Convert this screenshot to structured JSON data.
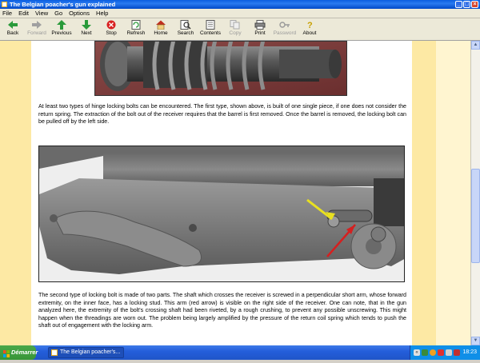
{
  "window": {
    "title": "The Belgian poacher's gun explained",
    "buttons": [
      "_",
      "□",
      "×"
    ]
  },
  "menu": [
    "File",
    "Edit",
    "View",
    "Go",
    "Options",
    "Help"
  ],
  "toolbar": [
    {
      "label": "Back",
      "icon": "back-arrow-icon",
      "enabled": true
    },
    {
      "label": "Forward",
      "icon": "forward-arrow-icon",
      "enabled": false
    },
    {
      "label": "Previous",
      "icon": "up-arrow-icon",
      "enabled": true
    },
    {
      "label": "Next",
      "icon": "down-arrow-icon",
      "enabled": true
    },
    {
      "label": "Stop",
      "icon": "stop-icon",
      "enabled": true
    },
    {
      "label": "Refresh",
      "icon": "refresh-icon",
      "enabled": true
    },
    {
      "label": "Home",
      "icon": "home-icon",
      "enabled": true
    },
    {
      "label": "Search",
      "icon": "search-icon",
      "enabled": true
    },
    {
      "label": "Contents",
      "icon": "contents-icon",
      "enabled": true
    },
    {
      "label": "Copy",
      "icon": "copy-icon",
      "enabled": false
    },
    {
      "label": "Print",
      "icon": "print-icon",
      "enabled": true
    },
    {
      "label": "Password",
      "icon": "password-icon",
      "enabled": false
    },
    {
      "label": "About",
      "icon": "about-icon",
      "enabled": true
    }
  ],
  "content": {
    "para1": "At least two types of hinge locking bolts can be encountered. The first type, shown above, is built of one single piece, if one does not consider the return spring. The extraction of the bolt out of the receiver requires that the barrel is first removed. Once the barrel is removed, the locking bolt can be pulled off by the left side.",
    "para2": "The second type of locking bolt is made of two parts. The shaft which crosses the receiver is screwed in a perpendicular short arm, whose forward extremity, on the inner face, has a locking stud. This arm (red arrow) is visible on the right side of the receiver. One can note, that in the gun analyzed here, the extremity of the bolt's crossing shaft had been riveted, by a rough crushing, to prevent any possible unscrewing. This might happen when the threadings are worn out. The problem being largely amplified by the pressure of the return coil spring which tends to push the shaft out of engagement with the locking arm."
  },
  "taskbar": {
    "start_label": "Démarrer",
    "task_label": "The Belgian poacher's...",
    "clock": "18:23"
  },
  "colors": {
    "margin_left": "#fde9a4",
    "margin_right": "#fde9a4",
    "arrow_yellow": "#e8e020",
    "arrow_red": "#d42020"
  }
}
